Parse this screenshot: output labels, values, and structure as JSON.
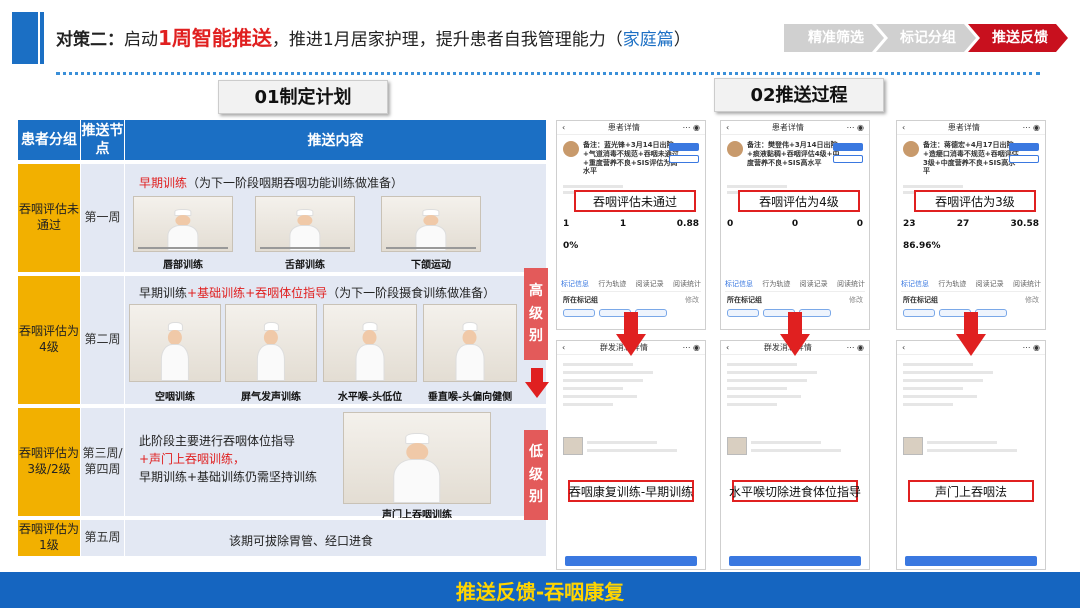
{
  "header": {
    "lead": "对策二：",
    "pre": "启动",
    "highlight": "1周智能推送",
    "mid": "，推进1月居家护理，提升患者自我管理能力（",
    "home": "家庭篇",
    "end": "）",
    "steps": [
      "精准筛选",
      "标记分组",
      "推送反馈"
    ],
    "active_step": "推送反馈",
    "accent": "#1b6fc4",
    "active_color": "#c8101e"
  },
  "section1_title": "01制定计划",
  "section2_title": "02推送过程",
  "table": {
    "headers": [
      "患者分组",
      "推送节点",
      "推送内容"
    ],
    "rows": [
      {
        "group": "吞咽评估未通过",
        "node": "第一周",
        "content_label": "早期训练",
        "content_note": "（为下一阶段咽期吞咽功能训练做准备）",
        "videos": [
          "唇部训练",
          "舌部训练",
          "下颌运动"
        ]
      },
      {
        "group": "吞咽评估为4级",
        "node": "第二周",
        "content_a": "早期训练",
        "content_b": "+基础训练",
        "content_c": "+吞咽体位指导",
        "content_note": "（为下一阶段摄食训练做准备）",
        "videos": [
          "空咽训练",
          "屏气发声训练",
          "水平喉-头低位",
          "垂直喉-头偏向健侧"
        ]
      },
      {
        "group": "吞咽评估为3级/2级",
        "node": "第三周/第四周",
        "line1": "此阶段主要进行吞咽体位指导",
        "line2": "+声门上吞咽训练，",
        "line3": "早期训练+基础训练仍需坚持训练",
        "video": "声门上吞咽训练"
      },
      {
        "group": "吞咽评估为1级",
        "node": "第五周",
        "text": "该期可拔除胃管、经口进食"
      }
    ],
    "high_level": "高级别",
    "low_level": "低级别"
  },
  "phones": [
    {
      "title": "患者详情",
      "memo": "备注：蓝光锋+3月14日出院+气道消毒不规范+吞咽未通过+重度营养不良+SIS评估为高水平",
      "assess": "吞咽评估未通过",
      "stats": [
        "1",
        "1",
        "0.88"
      ],
      "pct": "0%",
      "tabs": [
        "标记信息",
        "行为轨迹",
        "阅读记录",
        "阅读统计"
      ],
      "sub": "所在标记组",
      "sub_right": "修改",
      "detail_title": "群发消息详情",
      "push": "吞咽康复训练-早期训练"
    },
    {
      "title": "患者详情",
      "memo": "备注：樊登伟+3月14日出院+痰液黏稠+吞咽评估4级+中度营养不良+SIS高水平",
      "assess": "吞咽评估为4级",
      "stats": [
        "0",
        "0",
        "0"
      ],
      "tabs": [
        "标记信息",
        "行为轨迹",
        "阅读记录",
        "阅读统计"
      ],
      "sub": "所在标记组",
      "sub_right": "修改",
      "detail_title": "群发消息详情",
      "push": "水平喉切除进食体位指导"
    },
    {
      "title": "患者详情",
      "memo": "备注：蒋德宏+4月17日出院+造瘘口消毒不规范+吞咽评估3级+中度营养不良+SIS高水平",
      "assess": "吞咽评估为3级",
      "stats": [
        "23",
        "27",
        "30.58"
      ],
      "pct": "86.96%",
      "tabs": [
        "标记信息",
        "行为轨迹",
        "阅读记录",
        "阅读统计"
      ],
      "sub": "所在标记组",
      "sub_right": "修改",
      "detail_title": "",
      "push": "声门上吞咽法"
    }
  ],
  "footer": "推送反馈-吞咽康复"
}
